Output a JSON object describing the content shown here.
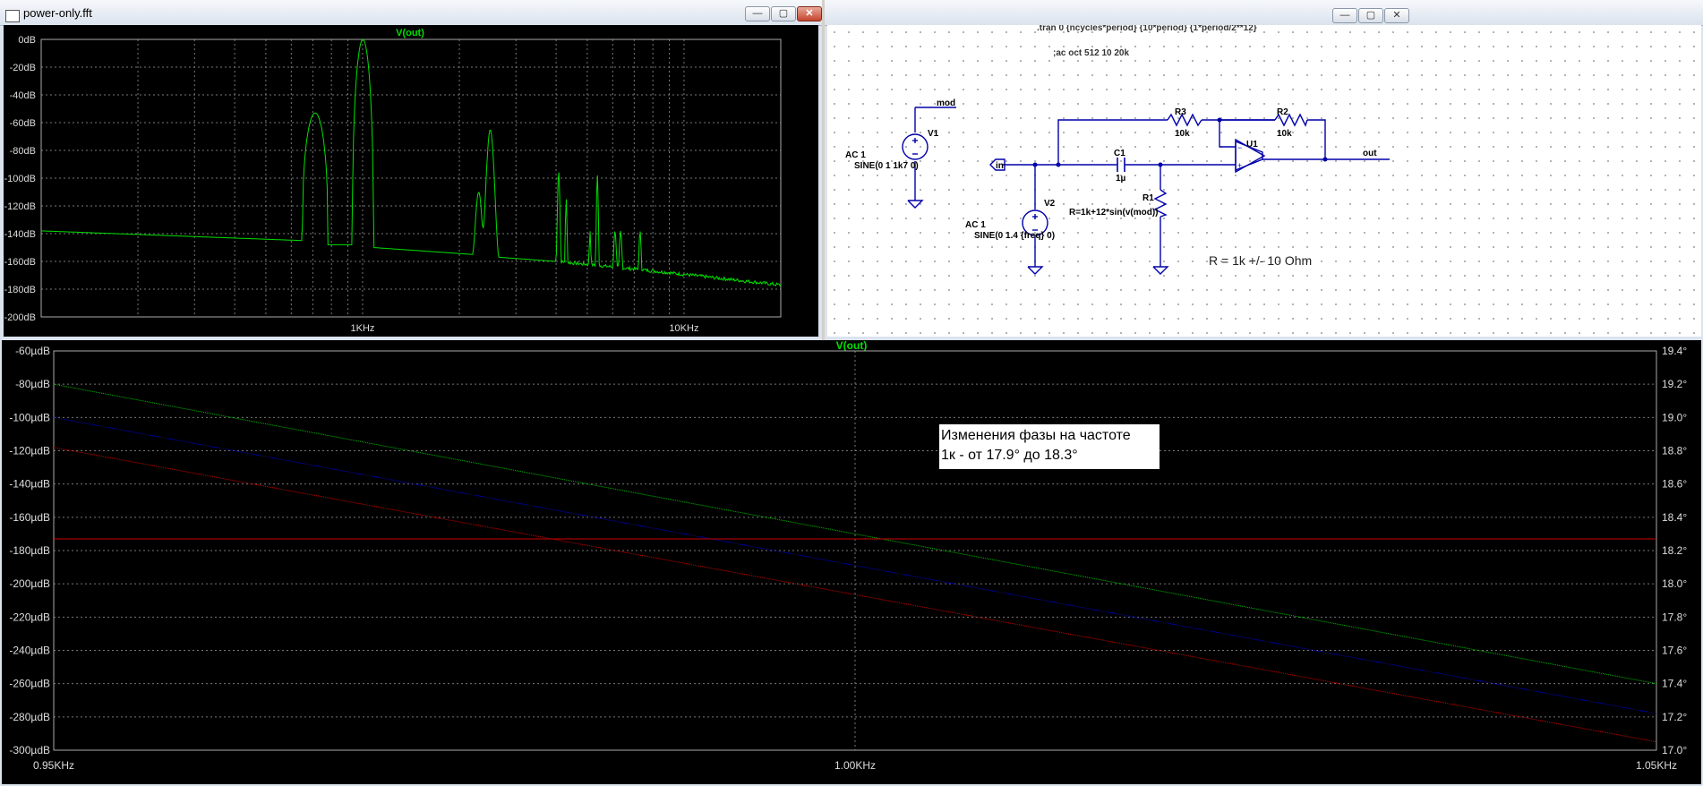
{
  "fft_window": {
    "title": "power-only.fft",
    "trace_name": "V(out)",
    "y_ticks": [
      "0dB",
      "-20dB",
      "-40dB",
      "-60dB",
      "-80dB",
      "-100dB",
      "-120dB",
      "-140dB",
      "-160dB",
      "-180dB",
      "-200dB"
    ],
    "x_ticks": [
      "1KHz",
      "10KHz"
    ],
    "trace_color": "#00e000",
    "controls": {
      "minimize": "—",
      "maximize": "▢",
      "close": "✕"
    }
  },
  "schematic_window": {
    "directives": [
      ".tran 0 {ncycles*period} {10*period} {1*period/2**12}",
      ";ac oct 512 10 20k"
    ],
    "labels": {
      "mod": "mod",
      "v1": "V1",
      "v1_ac": "AC 1",
      "v1_sine": "SINE(0 1 1k7 0)",
      "in": "in",
      "v2": "V2",
      "v2_ac": "AC 1",
      "v2_sine": "SINE(0 1.4 {freq} 0)",
      "c1": "C1",
      "c1_val": "1µ",
      "r1": "R1",
      "r1_val": "R=1k+12*sin(v(mod))",
      "r3": "R3",
      "r3_val": "10k",
      "r2": "R2",
      "r2_val": "10k",
      "u1": "U1",
      "out": "out"
    },
    "note": "R = 1k +/- 10 Ohm",
    "wire_color": "#0000aa",
    "controls": {
      "minimize": "—",
      "maximize": "▢",
      "close": "✕"
    }
  },
  "ac_window": {
    "trace_name": "V(out)",
    "y_left_ticks": [
      "-60µdB",
      "-80µdB",
      "-100µdB",
      "-120µdB",
      "-140µdB",
      "-160µdB",
      "-180µdB",
      "-200µdB",
      "-220µdB",
      "-240µdB",
      "-260µdB",
      "-280µdB",
      "-300µdB"
    ],
    "y_right_ticks": [
      "19.4°",
      "19.2°",
      "19.0°",
      "18.8°",
      "18.6°",
      "18.4°",
      "18.2°",
      "18.0°",
      "17.8°",
      "17.6°",
      "17.4°",
      "17.2°",
      "17.0°"
    ],
    "x_ticks": [
      "0.95KHz",
      "1.00KHz",
      "1.05KHz"
    ],
    "annotation": [
      "Изменения фазы на частоте",
      "1к - от 17.9° до 18.3°"
    ]
  },
  "chart_data": [
    {
      "type": "line",
      "title": "V(out)",
      "xscale": "log",
      "xlim": [
        100,
        20000
      ],
      "ylim": [
        -200,
        0
      ],
      "yunit": "dB",
      "grid": true,
      "series": [
        {
          "name": "V(out)",
          "color": "#00e000",
          "peaks": [
            {
              "f_start": 650,
              "f_end": 780,
              "level": -53,
              "kind": "round"
            },
            {
              "f_start": 930,
              "f_end": 1080,
              "level": 0,
              "kind": "round"
            },
            {
              "f_start": 2350,
              "f_end": 2650,
              "level": -65,
              "kind": "spike"
            },
            {
              "f_start": 2200,
              "f_end": 2400,
              "level": -110,
              "kind": "spike"
            },
            {
              "f_start": 4000,
              "f_end": 4150,
              "level": -95,
              "kind": "spike"
            },
            {
              "f_start": 4250,
              "f_end": 4350,
              "level": -115,
              "kind": "spike"
            },
            {
              "f_start": 5300,
              "f_end": 5450,
              "level": -97,
              "kind": "spike"
            },
            {
              "f_start": 5050,
              "f_end": 5150,
              "level": -138,
              "kind": "spike"
            },
            {
              "f_start": 6000,
              "f_end": 6200,
              "level": -138,
              "kind": "spike"
            },
            {
              "f_start": 6250,
              "f_end": 6450,
              "level": -138,
              "kind": "spike"
            },
            {
              "f_start": 7200,
              "f_end": 7400,
              "level": -138,
              "kind": "spike"
            }
          ],
          "floor": [
            [
              100,
              -138
            ],
            [
              650,
              -145
            ],
            [
              780,
              -148
            ],
            [
              930,
              -148
            ],
            [
              1080,
              -150
            ],
            [
              2200,
              -155
            ],
            [
              2650,
              -157
            ],
            [
              4000,
              -160
            ],
            [
              7400,
              -166
            ],
            [
              20000,
              -177
            ]
          ]
        }
      ]
    },
    {
      "type": "line",
      "title": "V(out)",
      "xlim": [
        950,
        1050
      ],
      "ylim": [
        -300,
        -60
      ],
      "ylim_right": [
        17.0,
        19.4
      ],
      "grid": true,
      "series": [
        {
          "name": "",
          "color": "#00c000",
          "axis": "left",
          "points": [
            [
              950,
              -80
            ],
            [
              1050,
              -260
            ]
          ]
        },
        {
          "name": "",
          "color": "#0000cc",
          "axis": "left",
          "points": [
            [
              950,
              -100
            ],
            [
              1050,
              -278
            ]
          ]
        },
        {
          "name": "",
          "color": "#cc0000",
          "axis": "left",
          "points": [
            [
              950,
              -118
            ],
            [
              1050,
              -295
            ]
          ]
        },
        {
          "name": "",
          "color": "#cc0000",
          "axis": "left",
          "points": [
            [
              950,
              -173
            ],
            [
              1050,
              -173
            ]
          ]
        }
      ]
    }
  ]
}
